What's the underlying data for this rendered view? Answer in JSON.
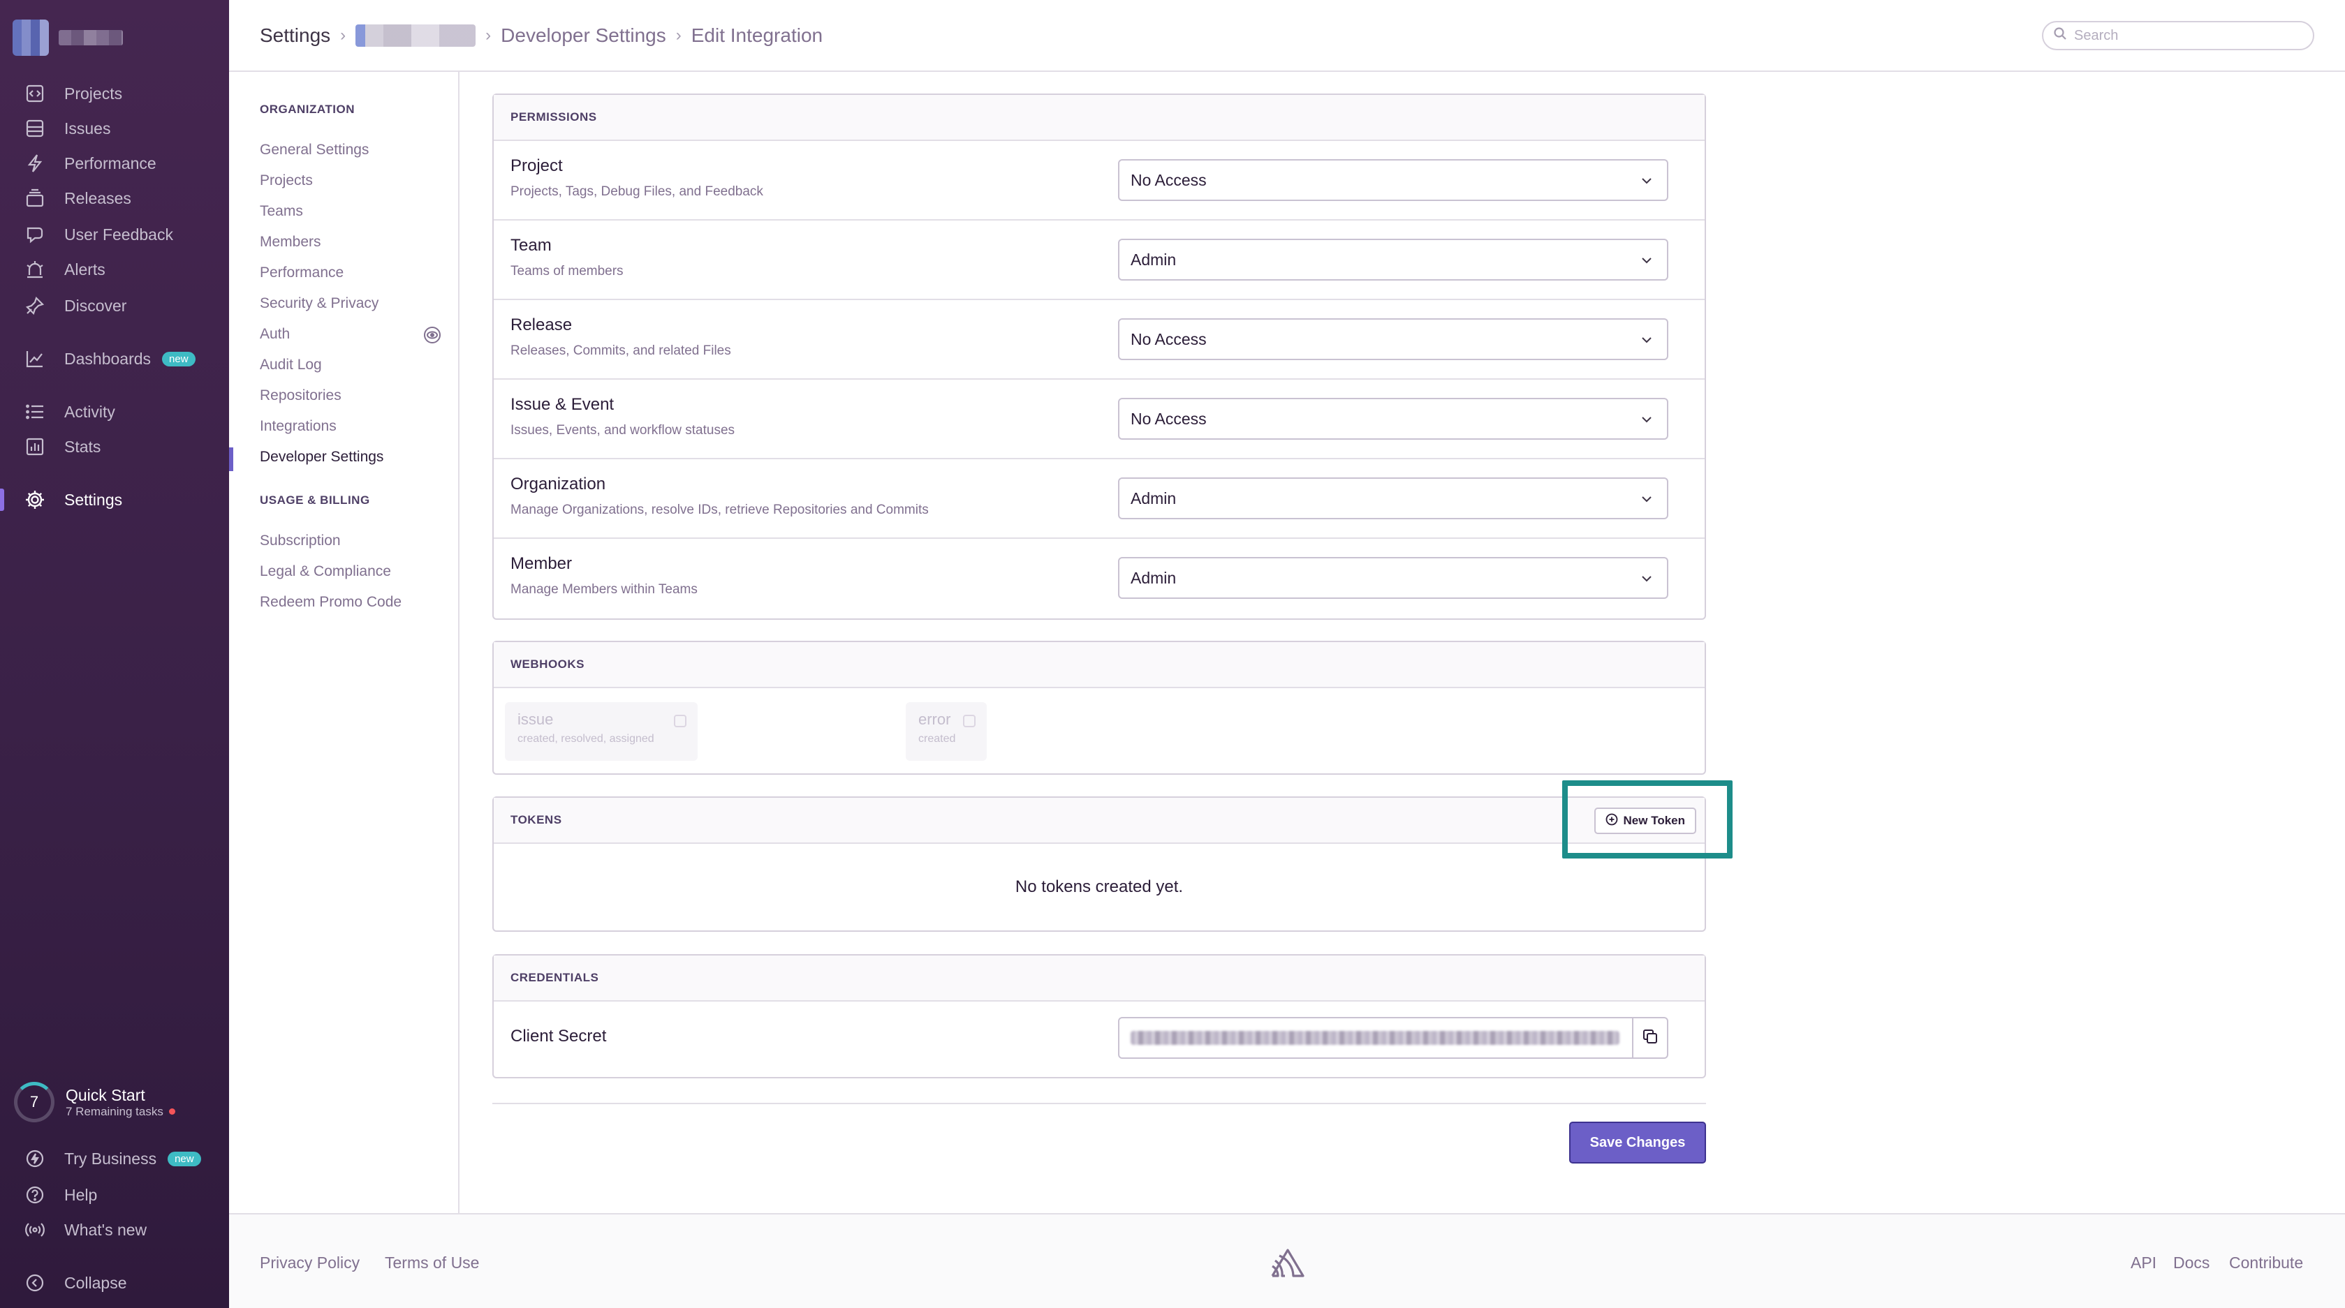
{
  "sidebar": {
    "items": [
      {
        "label": "Projects",
        "icon": "projects-icon"
      },
      {
        "label": "Issues",
        "icon": "issues-icon"
      },
      {
        "label": "Performance",
        "icon": "performance-icon"
      },
      {
        "label": "Releases",
        "icon": "releases-icon"
      },
      {
        "label": "User Feedback",
        "icon": "user-feedback-icon"
      },
      {
        "label": "Alerts",
        "icon": "alerts-icon"
      },
      {
        "label": "Discover",
        "icon": "discover-icon"
      },
      {
        "label": "Dashboards",
        "icon": "dashboards-icon",
        "badge": "new"
      },
      {
        "label": "Activity",
        "icon": "activity-icon"
      },
      {
        "label": "Stats",
        "icon": "stats-icon"
      },
      {
        "label": "Settings",
        "icon": "settings-icon",
        "active": true
      }
    ],
    "quick_start": {
      "count": "7",
      "title": "Quick Start",
      "subtitle": "7 Remaining tasks"
    },
    "bottom": [
      {
        "label": "Try Business",
        "icon": "lightning-icon",
        "badge": "new"
      },
      {
        "label": "Help",
        "icon": "help-icon"
      },
      {
        "label": "What's new",
        "icon": "broadcast-icon"
      },
      {
        "label": "Collapse",
        "icon": "collapse-icon"
      }
    ]
  },
  "header": {
    "breadcrumbs": [
      "Settings",
      "Developer Settings",
      "Edit Integration"
    ],
    "search_placeholder": "Search"
  },
  "settings_nav": {
    "organization_heading": "ORGANIZATION",
    "organization_items": [
      "General Settings",
      "Projects",
      "Teams",
      "Members",
      "Performance",
      "Security & Privacy",
      "Auth",
      "Audit Log",
      "Repositories",
      "Integrations",
      "Developer Settings"
    ],
    "billing_heading": "USAGE & BILLING",
    "billing_items": [
      "Subscription",
      "Legal & Compliance",
      "Redeem Promo Code"
    ]
  },
  "permissions": {
    "heading": "PERMISSIONS",
    "rows": [
      {
        "label": "Project",
        "help": "Projects, Tags, Debug Files, and Feedback",
        "value": "No Access"
      },
      {
        "label": "Team",
        "help": "Teams of members",
        "value": "Admin"
      },
      {
        "label": "Release",
        "help": "Releases, Commits, and related Files",
        "value": "No Access"
      },
      {
        "label": "Issue & Event",
        "help": "Issues, Events, and workflow statuses",
        "value": "No Access"
      },
      {
        "label": "Organization",
        "help": "Manage Organizations, resolve IDs, retrieve Repositories and Commits",
        "value": "Admin"
      },
      {
        "label": "Member",
        "help": "Manage Members within Teams",
        "value": "Admin"
      }
    ]
  },
  "webhooks": {
    "heading": "WEBHOOKS",
    "options": [
      {
        "title": "issue",
        "subtitle": "created, resolved, assigned"
      },
      {
        "title": "error",
        "subtitle": "created"
      }
    ]
  },
  "tokens": {
    "heading": "TOKENS",
    "new_token_label": "New Token",
    "empty_message": "No tokens created yet."
  },
  "credentials": {
    "heading": "CREDENTIALS",
    "client_secret_label": "Client Secret"
  },
  "actions": {
    "save_label": "Save Changes"
  },
  "footer": {
    "links_left": [
      "Privacy Policy",
      "Terms of Use"
    ],
    "links_right": [
      "API",
      "Docs",
      "Contribute"
    ]
  },
  "colors": {
    "sidebar": "#3a2147",
    "accent": "#6c5fc7",
    "highlight": "#1d8d8a",
    "badge": "#3ebbc4"
  }
}
